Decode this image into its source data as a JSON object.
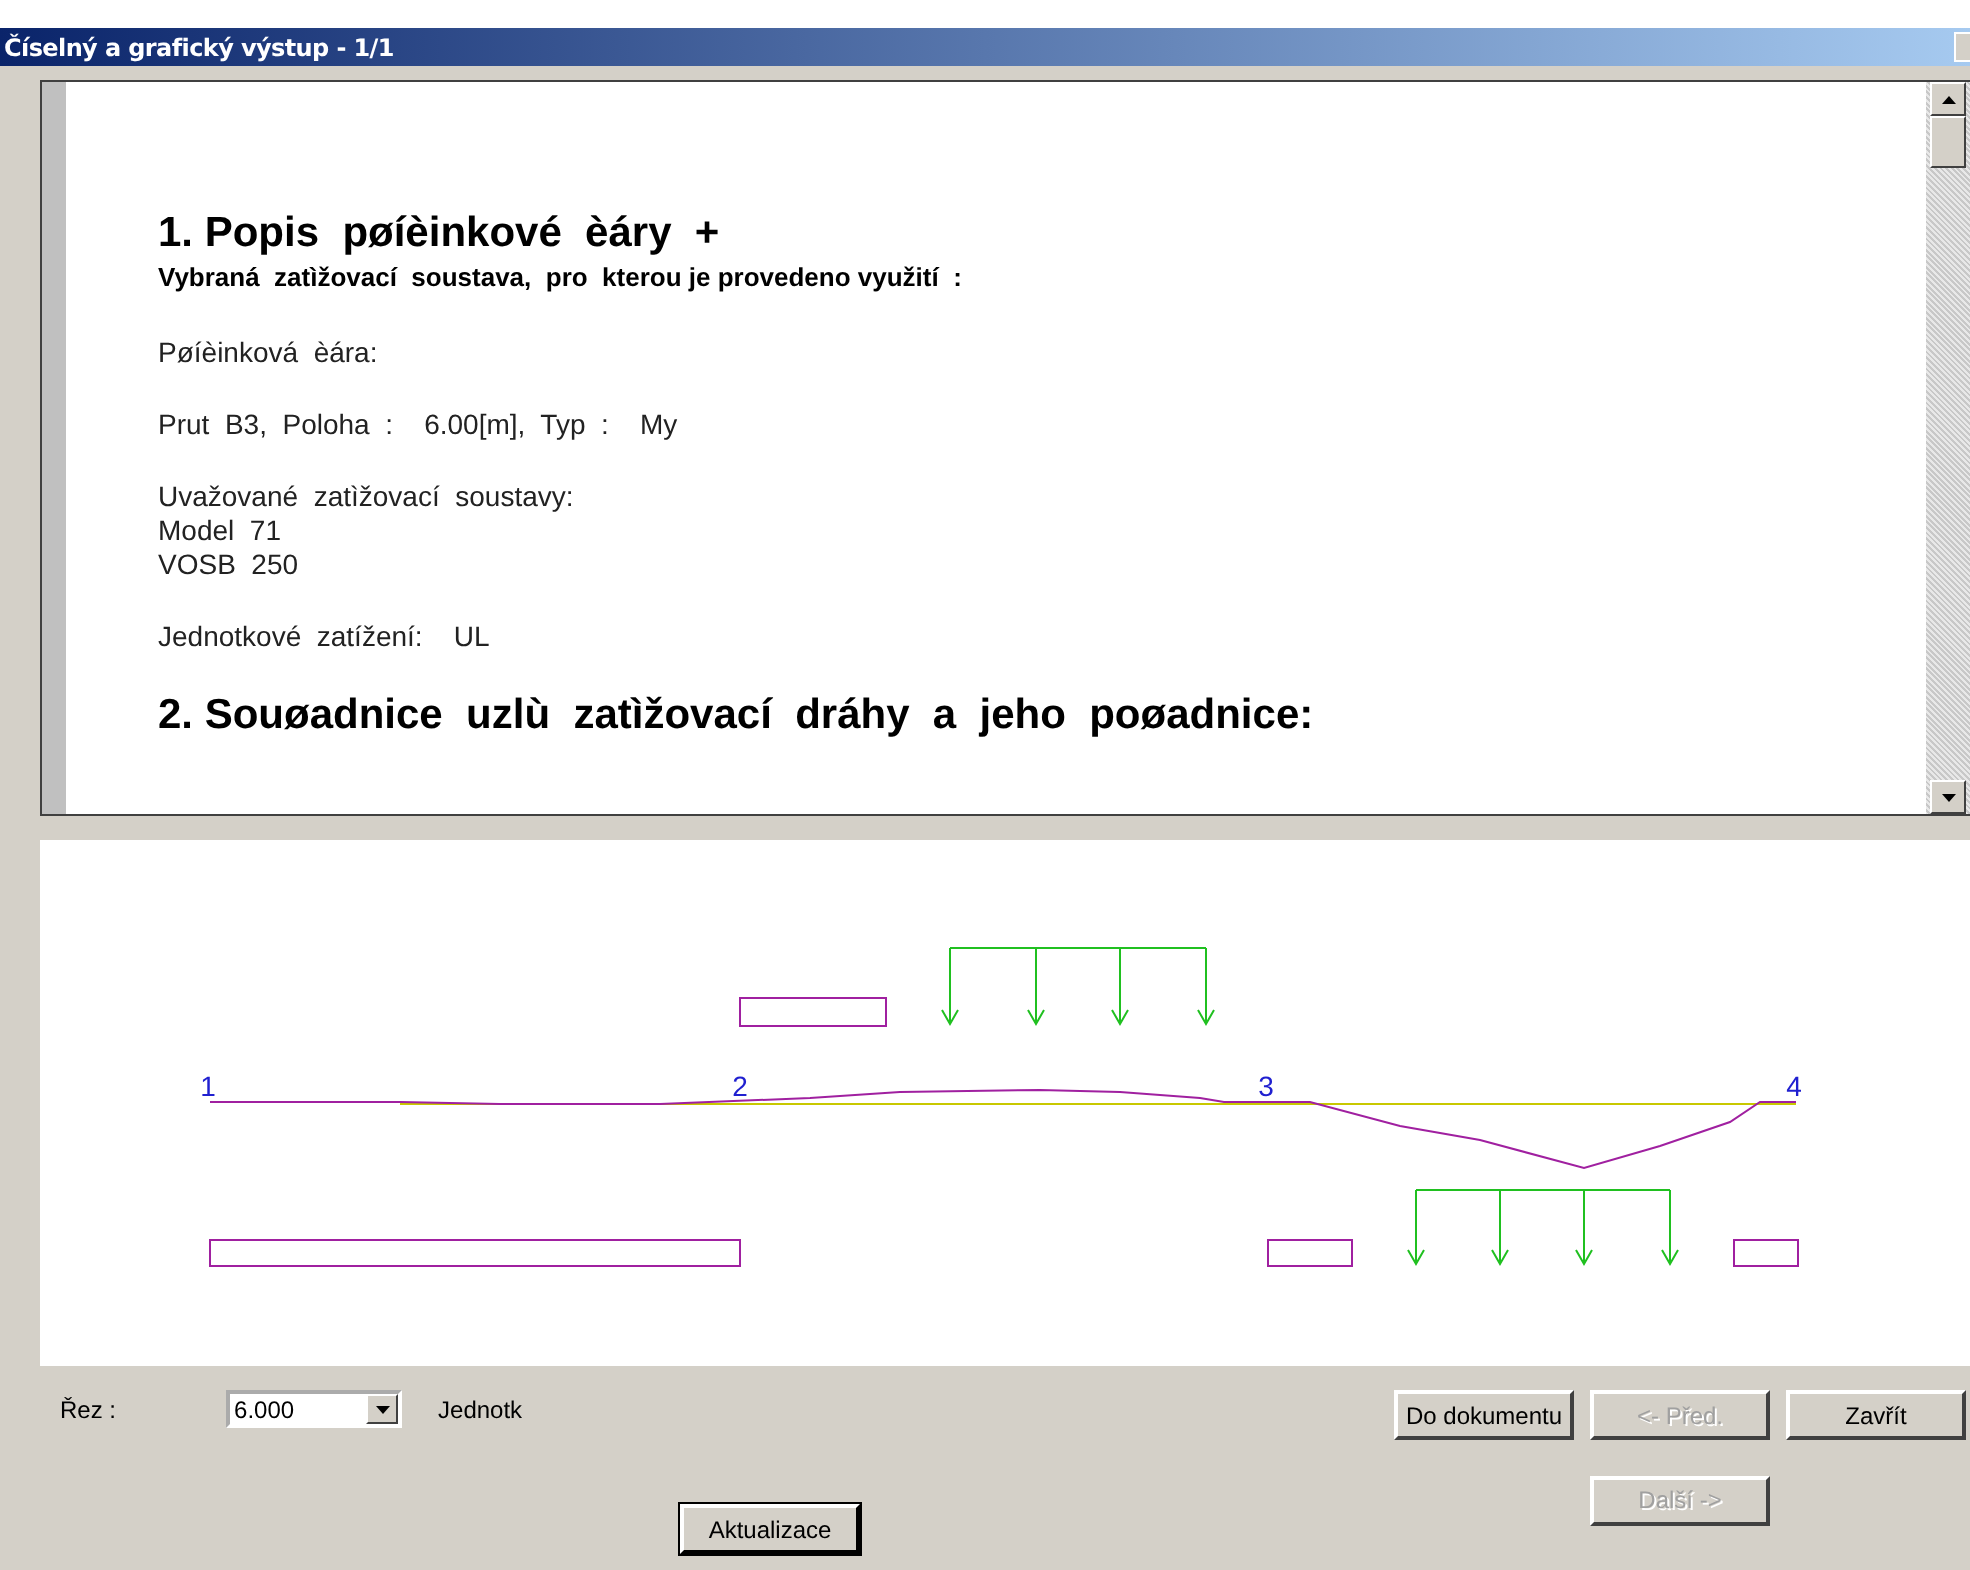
{
  "window": {
    "title": "Číselný a grafický výstup - 1/1"
  },
  "report": {
    "items": [
      {
        "kind": "h1",
        "text": "1. Popis  pøíèinkové  èáry  +"
      },
      {
        "kind": "h2",
        "text": "Vybraná  zatìžovací  soustava,  pro  kterou je provedeno využití  :"
      },
      {
        "kind": "p",
        "text": "Pøíèinková  èára:"
      },
      {
        "kind": "p",
        "text": "Prut  B3,  Poloha  :    6.00[m],  Typ  :    My"
      },
      {
        "kind": "p",
        "text": "Uvažované  zatìžovací  soustavy:\nModel  71\nVOSB  250"
      },
      {
        "kind": "p",
        "text": "Jednotkové  zatížení:    UL"
      },
      {
        "kind": "h1",
        "text": "2. Souøadnice  uzlù  zatìžovací  dráhy  a  jeho  poøadnice:"
      }
    ]
  },
  "diagram": {
    "nodes": [
      "1",
      "2",
      "3",
      "4"
    ]
  },
  "controls": {
    "section_label": "Řez :",
    "section_value": "6.000",
    "unit_label": "Jednotk",
    "buttons": [
      {
        "label": "Do dokumentu",
        "disabled": false
      },
      {
        "label": "<- Před.",
        "disabled": true
      },
      {
        "label": "Zavřít",
        "disabled": false
      },
      {
        "label": "Další ->",
        "disabled": true
      }
    ],
    "refresh": "Aktualizace"
  }
}
